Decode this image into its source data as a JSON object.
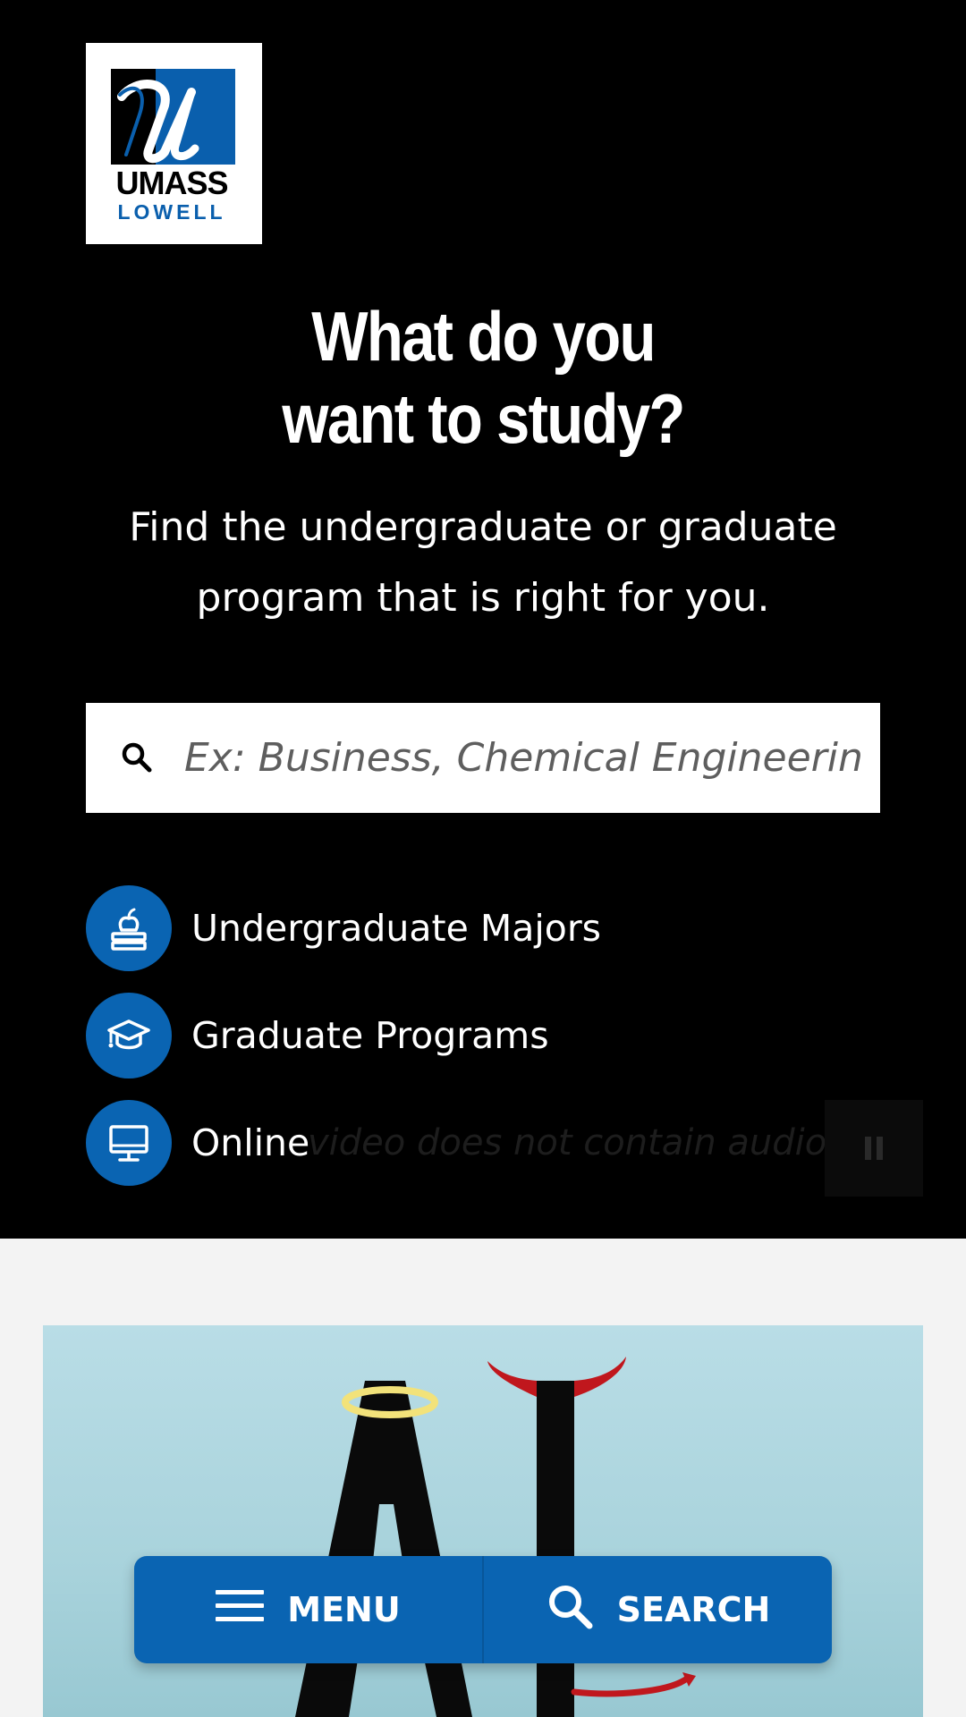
{
  "logo": {
    "line1": "UMASS",
    "line2": "LOWELL",
    "brand_blue": "#0a5fad"
  },
  "hero": {
    "title_line1": "What do you",
    "title_line2": "want to study?",
    "subtitle": "Find the undergraduate or graduate program that is right for you.",
    "search": {
      "placeholder": "Ex: Business, Chemical Engineering,",
      "icon": "search-icon"
    },
    "links": [
      {
        "label": "Undergraduate Majors",
        "icon": "apple-books-icon"
      },
      {
        "label": "Graduate Programs",
        "icon": "graduation-cap-icon"
      },
      {
        "label": "Online",
        "icon": "monitor-icon"
      }
    ],
    "video_note": "video does not contain audio",
    "pause_icon": "pause-icon"
  },
  "bottom_nav": {
    "menu_label": "MENU",
    "menu_icon": "hamburger-icon",
    "search_label": "SEARCH",
    "search_icon": "search-icon"
  },
  "colors": {
    "accent_blue": "#0a64b2",
    "hero_bg": "#000000",
    "page_bg": "#f3f3f3"
  }
}
